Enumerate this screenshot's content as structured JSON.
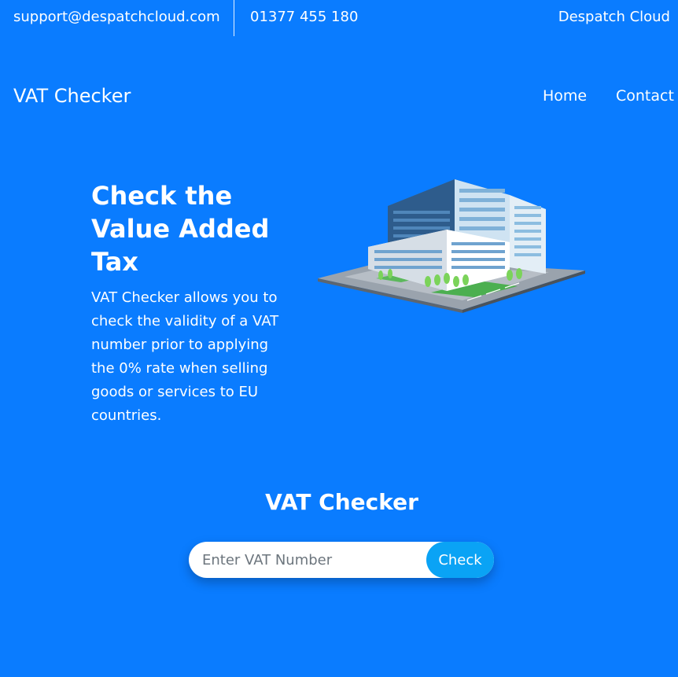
{
  "topbar": {
    "email": "support@despatchcloud.com",
    "phone": "01377 455 180",
    "company": "Despatch Cloud"
  },
  "nav": {
    "brand": "VAT Checker",
    "items": [
      {
        "label": "Home"
      },
      {
        "label": "Contact"
      }
    ]
  },
  "hero": {
    "title": "Check the Value Added Tax",
    "description": "VAT Checker allows you to check the validity of a VAT number prior to applying the 0% rate when selling goods or services to EU countries.",
    "image": "office-building-illustration"
  },
  "checker": {
    "heading": "VAT Checker",
    "input_placeholder": "Enter VAT Number",
    "input_value": "",
    "button_label": "Check"
  },
  "colors": {
    "background": "#0a7cff",
    "button": "#0aa3f5",
    "text": "#ffffff"
  }
}
